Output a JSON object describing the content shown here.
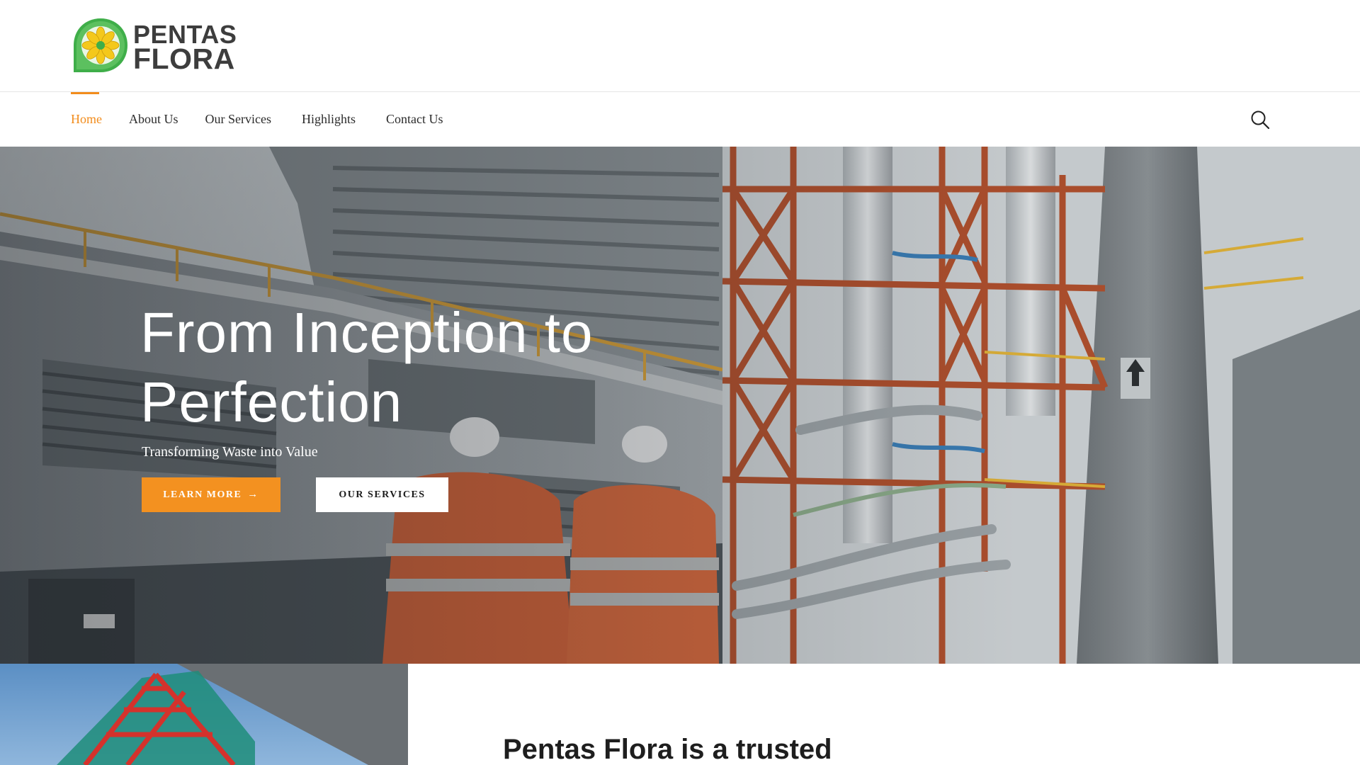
{
  "brand": {
    "name_line1": "PENTAS",
    "name_line2": "FLORA",
    "colors": {
      "green": "#3fae49",
      "yellow": "#f4c81b",
      "dark": "#3d3d3d"
    }
  },
  "nav": {
    "items": [
      {
        "label": "Home",
        "active": true,
        "has_dropdown": false
      },
      {
        "label": "About Us",
        "active": false,
        "has_dropdown": false
      },
      {
        "label": "Our Services",
        "active": false,
        "has_dropdown": true
      },
      {
        "label": "Highlights",
        "active": false,
        "has_dropdown": true
      },
      {
        "label": "Contact Us",
        "active": false,
        "has_dropdown": false
      }
    ],
    "dropdown_glyph": "",
    "search_icon": "search-icon",
    "accent_color": "#f28c1c"
  },
  "hero": {
    "title": "From Inception to Perfection",
    "subtitle": "Transforming Waste into Value",
    "primary_button": {
      "label": "LEARN MORE",
      "icon": "→",
      "color": "#f39120"
    },
    "secondary_button": {
      "label": "OUR SERVICES"
    }
  },
  "about": {
    "heading": "Pentas Flora is a trusted"
  }
}
